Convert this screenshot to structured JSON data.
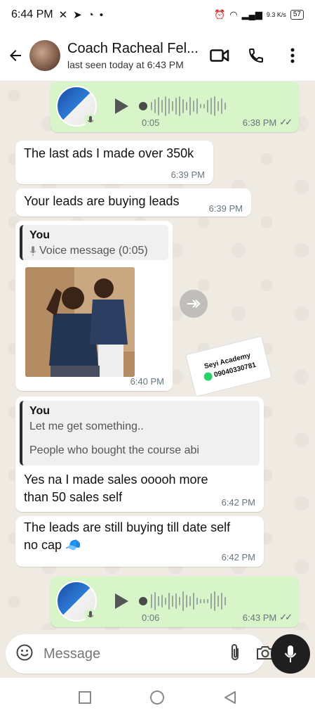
{
  "status_bar": {
    "time": "6:44 PM",
    "net_speed": "9.3 K/s",
    "battery": "57"
  },
  "header": {
    "contact_name": "Coach Racheal Fel...",
    "last_seen": "last seen today at 6:43 PM"
  },
  "messages": [
    {
      "type": "voice",
      "direction": "out",
      "duration": "0:05",
      "time": "6:38 PM",
      "status": "read"
    },
    {
      "type": "text",
      "direction": "in",
      "text": "The last ads I made over 350k",
      "time": "6:39 PM"
    },
    {
      "type": "text",
      "direction": "in",
      "text": "Your leads are buying leads",
      "time": "6:39 PM"
    },
    {
      "type": "reply_image",
      "direction": "in",
      "quote_author": "You",
      "quote_text": "Voice message (0:05)",
      "time": "6:40 PM"
    },
    {
      "type": "reply_text",
      "direction": "in",
      "quote_author": "You",
      "quote_line1": "Let me get something..",
      "quote_line2": "People who bought the course abi",
      "text_line1": "Yes na I made sales ooooh more",
      "text_line2": "than 50 sales self",
      "time": "6:42 PM"
    },
    {
      "type": "text",
      "direction": "in",
      "text_line1": "The leads are still buying till date self",
      "text_line2": "no cap 🧢",
      "time": "6:42 PM"
    },
    {
      "type": "voice",
      "direction": "out",
      "duration": "0:06",
      "time": "6:43 PM",
      "status": "read"
    }
  ],
  "watermark": {
    "line1": "Seyi Academy",
    "line2": "09040330781"
  },
  "composer": {
    "placeholder": "Message"
  },
  "colors": {
    "outgoing_bubble": "#d7f5c8",
    "incoming_bubble": "#ffffff",
    "chat_bg": "#efeae2",
    "accent_green": "#25d366"
  },
  "icons": [
    "back-arrow-icon",
    "video-call-icon",
    "phone-icon",
    "more-vert-icon",
    "play-icon",
    "mic-icon",
    "forward-icon",
    "emoji-icon",
    "attach-icon",
    "camera-icon",
    "square-nav-icon",
    "circle-nav-icon",
    "triangle-nav-icon"
  ]
}
